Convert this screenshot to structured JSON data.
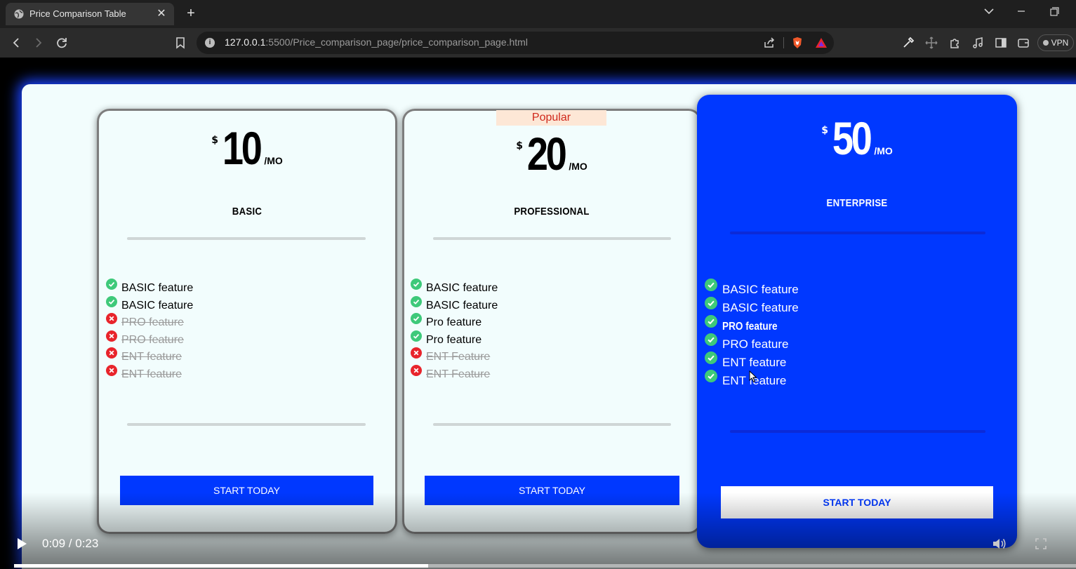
{
  "browser": {
    "tab_title": "Price Comparison Table",
    "url_host": "127.0.0.1",
    "url_rest": ":5500/Price_comparison_page/price_comparison_page.html",
    "vpn_label": "VPN"
  },
  "plans": [
    {
      "currency": "$",
      "amount": "10",
      "period": "/MO",
      "name": "BASIC",
      "features": [
        {
          "label": "BASIC feature",
          "included": true
        },
        {
          "label": "BASIC feature",
          "included": true
        },
        {
          "label": "PRO feature",
          "included": false
        },
        {
          "label": "PRO feature",
          "included": false
        },
        {
          "label": "ENT feature",
          "included": false
        },
        {
          "label": "ENT feature",
          "included": false
        }
      ],
      "cta": "START TODAY"
    },
    {
      "badge": "Popular",
      "currency": "$",
      "amount": "20",
      "period": "/MO",
      "name": "PROFESSIONAL",
      "features": [
        {
          "label": "BASIC feature",
          "included": true
        },
        {
          "label": "BASIC feature",
          "included": true
        },
        {
          "label": "Pro feature",
          "included": true
        },
        {
          "label": "Pro feature",
          "included": true
        },
        {
          "label": "ENT Feature",
          "included": false
        },
        {
          "label": "ENT Feature",
          "included": false
        }
      ],
      "cta": "START TODAY"
    },
    {
      "currency": "$",
      "amount": "50",
      "period": "/MO",
      "name": "ENTERPRISE",
      "features": [
        {
          "label": "BASIC feature",
          "included": true
        },
        {
          "label": "BASIC feature",
          "included": true
        },
        {
          "label": "PRO feature",
          "included": true
        },
        {
          "label": "PRO feature",
          "included": true
        },
        {
          "label": "ENT feature",
          "included": true
        },
        {
          "label": "ENT feature",
          "included": true
        }
      ],
      "cta": "START TODAY"
    }
  ],
  "player": {
    "time": "0:09 / 0:23",
    "progress_fraction": 0.39
  },
  "colors": {
    "accent_blue": "#0038ff",
    "check_green": "#3ec97a",
    "cross_red": "#e8242b",
    "popular_bg": "#fde7d6",
    "popular_text": "#d0281b"
  }
}
